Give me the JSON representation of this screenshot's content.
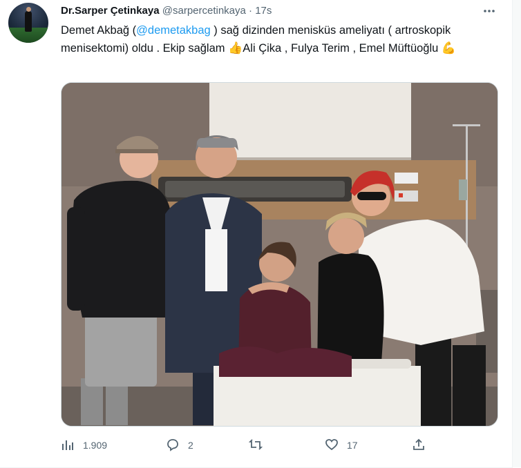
{
  "author": {
    "name": "Dr.Sarper Çetinkaya",
    "handle": "@sarpercetinkaya",
    "separator": "·",
    "time": "17s"
  },
  "tweet": {
    "text_1": "Demet Akbağ (",
    "mention": "@demetakbag",
    "text_2": " ) sağ dizinden menisküs ameliyatı ( artroskopik menisektomi) oldu . Ekip sağlam ",
    "emoji_1": "👍",
    "text_3": "Ali Çika , Fulya Terim , Emel Müftüoğlu ",
    "emoji_2": "💪"
  },
  "media": {
    "description_icon": "photo"
  },
  "actions": {
    "views": "1.909",
    "replies": "2",
    "retweets": "",
    "likes": "17"
  },
  "colors": {
    "accent": "#1d9bf0",
    "secondary_text": "#536471",
    "primary_text": "#0f1419"
  },
  "icons": [
    "more-icon",
    "views-icon",
    "reply-icon",
    "retweet-icon",
    "like-icon",
    "share-icon"
  ]
}
